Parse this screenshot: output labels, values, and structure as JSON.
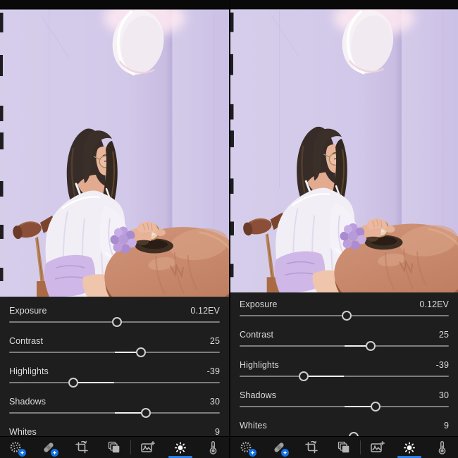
{
  "app": {
    "kind": "photo-editing side-by-side comparison",
    "panes": [
      {
        "side": "left"
      },
      {
        "side": "right"
      }
    ]
  },
  "colors": {
    "panel_bg": "#1e1e1e",
    "toolbar_bg": "#151515",
    "accent_blue": "#2b7de0",
    "badge_blue": "#1273e6",
    "slider_track": "#7d7d7d",
    "slider_fill": "#f2f2f2",
    "text": "#dcdcdc"
  },
  "sliders": [
    {
      "label": "Exposure",
      "display": "0.12EV",
      "value": 0.12,
      "min": -5,
      "max": 5
    },
    {
      "label": "Contrast",
      "display": "25",
      "value": 25,
      "min": -100,
      "max": 100
    },
    {
      "label": "Highlights",
      "display": "-39",
      "value": -39,
      "min": -100,
      "max": 100
    },
    {
      "label": "Shadows",
      "display": "30",
      "value": 30,
      "min": -100,
      "max": 100
    },
    {
      "label": "Whites",
      "display": "9",
      "value": 9,
      "min": -100,
      "max": 100
    }
  ],
  "toolbar": {
    "tools": [
      {
        "name": "masking-tool",
        "icon": "masking-icon",
        "badge": true,
        "active": false
      },
      {
        "name": "healing-tool",
        "icon": "healing-icon",
        "badge": true,
        "active": false
      },
      {
        "name": "crop-tool",
        "icon": "crop-icon",
        "badge": false,
        "active": false
      },
      {
        "name": "versions-tool",
        "icon": "versions-icon",
        "badge": false,
        "active": false
      },
      {
        "name": "image-plus-tool",
        "icon": "image-plus-icon",
        "badge": false,
        "active": false
      },
      {
        "name": "light-tool",
        "icon": "light-icon",
        "badge": false,
        "active": true
      },
      {
        "name": "color-tool",
        "icon": "color-icon",
        "badge": false,
        "active": false
      }
    ]
  },
  "photo_palette": {
    "wall": "#d3c9e9",
    "wall_corner_shadow": "#c2b6de",
    "lamp": "#f6f1f5",
    "lamp_glow": "#ffeaf2",
    "hair": "#372c27",
    "skin": "#e7b297",
    "blouse": "#f2eef6",
    "shorts": "#cfb7e7",
    "scrunchie": "#b79ad9",
    "table": "#c98a6f",
    "chair": "#8a4f36",
    "top_bar": "#090909"
  }
}
